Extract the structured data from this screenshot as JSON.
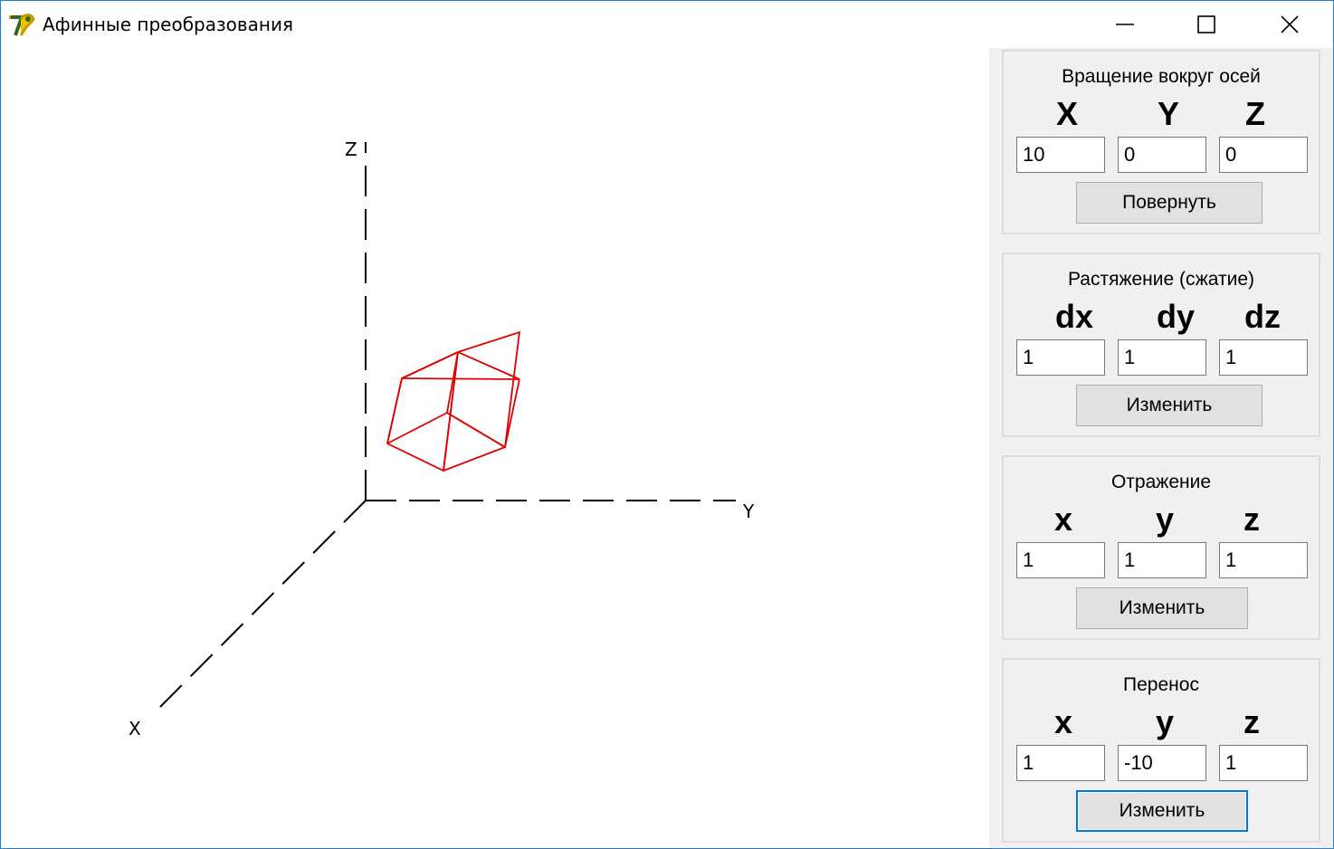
{
  "window": {
    "title": "Афинные преобразования",
    "icon": "app-logo-icon",
    "controls": [
      "minimize-icon",
      "maximize-icon",
      "close-icon"
    ]
  },
  "canvas": {
    "axis_labels": {
      "x": "X",
      "y": "Y",
      "z": "Z"
    },
    "axis_color": "#000000",
    "figure_color": "#e00000",
    "figure": "cube wireframe"
  },
  "rotation": {
    "title": "Вращение вокруг осей",
    "labels": [
      "X",
      "Y",
      "Z"
    ],
    "values": [
      "10",
      "0",
      "0"
    ],
    "button": "Повернуть"
  },
  "scaling": {
    "title": "Растяжение (сжатие)",
    "labels": [
      "dx",
      "dy",
      "dz"
    ],
    "values": [
      "1",
      "1",
      "1"
    ],
    "button": "Изменить"
  },
  "reflection": {
    "title": "Отражение",
    "labels": [
      "x",
      "y",
      "z"
    ],
    "values": [
      "1",
      "1",
      "1"
    ],
    "button": "Изменить"
  },
  "translation": {
    "title": "Перенос",
    "labels": [
      "x",
      "y",
      "z"
    ],
    "values": [
      "1",
      "-10",
      "1"
    ],
    "button": "Изменить"
  },
  "colors": {
    "panel_bg": "#f0f0f0",
    "button_bg": "#e1e1e1",
    "focus_border": "#0078d7",
    "window_border": "#1f7fd1"
  }
}
